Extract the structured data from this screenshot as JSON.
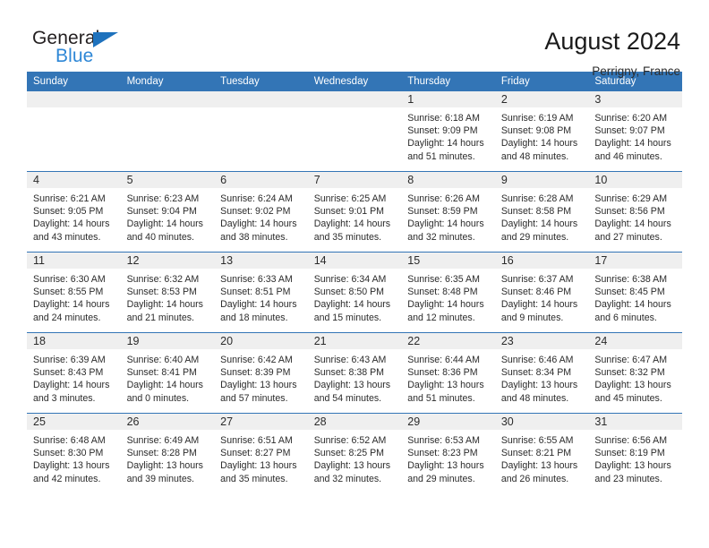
{
  "brand": {
    "name_part1": "General",
    "name_part2": "Blue",
    "flag_icon": "triangle-flag-icon",
    "color_blue": "#2e87d6",
    "color_flag": "#1e72bd"
  },
  "header": {
    "month_title": "August 2024",
    "location": "Perrigny, France"
  },
  "calendar": {
    "accent_color": "#3375b6",
    "band_color": "#efefef",
    "weekday_headers": [
      "Sunday",
      "Monday",
      "Tuesday",
      "Wednesday",
      "Thursday",
      "Friday",
      "Saturday"
    ],
    "weeks": [
      [
        {
          "day": "",
          "sunrise": "",
          "sunset": "",
          "daylight_line1": "",
          "daylight_line2": "",
          "empty": true
        },
        {
          "day": "",
          "sunrise": "",
          "sunset": "",
          "daylight_line1": "",
          "daylight_line2": "",
          "empty": true
        },
        {
          "day": "",
          "sunrise": "",
          "sunset": "",
          "daylight_line1": "",
          "daylight_line2": "",
          "empty": true
        },
        {
          "day": "",
          "sunrise": "",
          "sunset": "",
          "daylight_line1": "",
          "daylight_line2": "",
          "empty": true
        },
        {
          "day": "1",
          "sunrise": "Sunrise: 6:18 AM",
          "sunset": "Sunset: 9:09 PM",
          "daylight_line1": "Daylight: 14 hours",
          "daylight_line2": "and 51 minutes."
        },
        {
          "day": "2",
          "sunrise": "Sunrise: 6:19 AM",
          "sunset": "Sunset: 9:08 PM",
          "daylight_line1": "Daylight: 14 hours",
          "daylight_line2": "and 48 minutes."
        },
        {
          "day": "3",
          "sunrise": "Sunrise: 6:20 AM",
          "sunset": "Sunset: 9:07 PM",
          "daylight_line1": "Daylight: 14 hours",
          "daylight_line2": "and 46 minutes."
        }
      ],
      [
        {
          "day": "4",
          "sunrise": "Sunrise: 6:21 AM",
          "sunset": "Sunset: 9:05 PM",
          "daylight_line1": "Daylight: 14 hours",
          "daylight_line2": "and 43 minutes."
        },
        {
          "day": "5",
          "sunrise": "Sunrise: 6:23 AM",
          "sunset": "Sunset: 9:04 PM",
          "daylight_line1": "Daylight: 14 hours",
          "daylight_line2": "and 40 minutes."
        },
        {
          "day": "6",
          "sunrise": "Sunrise: 6:24 AM",
          "sunset": "Sunset: 9:02 PM",
          "daylight_line1": "Daylight: 14 hours",
          "daylight_line2": "and 38 minutes."
        },
        {
          "day": "7",
          "sunrise": "Sunrise: 6:25 AM",
          "sunset": "Sunset: 9:01 PM",
          "daylight_line1": "Daylight: 14 hours",
          "daylight_line2": "and 35 minutes."
        },
        {
          "day": "8",
          "sunrise": "Sunrise: 6:26 AM",
          "sunset": "Sunset: 8:59 PM",
          "daylight_line1": "Daylight: 14 hours",
          "daylight_line2": "and 32 minutes."
        },
        {
          "day": "9",
          "sunrise": "Sunrise: 6:28 AM",
          "sunset": "Sunset: 8:58 PM",
          "daylight_line1": "Daylight: 14 hours",
          "daylight_line2": "and 29 minutes."
        },
        {
          "day": "10",
          "sunrise": "Sunrise: 6:29 AM",
          "sunset": "Sunset: 8:56 PM",
          "daylight_line1": "Daylight: 14 hours",
          "daylight_line2": "and 27 minutes."
        }
      ],
      [
        {
          "day": "11",
          "sunrise": "Sunrise: 6:30 AM",
          "sunset": "Sunset: 8:55 PM",
          "daylight_line1": "Daylight: 14 hours",
          "daylight_line2": "and 24 minutes."
        },
        {
          "day": "12",
          "sunrise": "Sunrise: 6:32 AM",
          "sunset": "Sunset: 8:53 PM",
          "daylight_line1": "Daylight: 14 hours",
          "daylight_line2": "and 21 minutes."
        },
        {
          "day": "13",
          "sunrise": "Sunrise: 6:33 AM",
          "sunset": "Sunset: 8:51 PM",
          "daylight_line1": "Daylight: 14 hours",
          "daylight_line2": "and 18 minutes."
        },
        {
          "day": "14",
          "sunrise": "Sunrise: 6:34 AM",
          "sunset": "Sunset: 8:50 PM",
          "daylight_line1": "Daylight: 14 hours",
          "daylight_line2": "and 15 minutes."
        },
        {
          "day": "15",
          "sunrise": "Sunrise: 6:35 AM",
          "sunset": "Sunset: 8:48 PM",
          "daylight_line1": "Daylight: 14 hours",
          "daylight_line2": "and 12 minutes."
        },
        {
          "day": "16",
          "sunrise": "Sunrise: 6:37 AM",
          "sunset": "Sunset: 8:46 PM",
          "daylight_line1": "Daylight: 14 hours",
          "daylight_line2": "and 9 minutes."
        },
        {
          "day": "17",
          "sunrise": "Sunrise: 6:38 AM",
          "sunset": "Sunset: 8:45 PM",
          "daylight_line1": "Daylight: 14 hours",
          "daylight_line2": "and 6 minutes."
        }
      ],
      [
        {
          "day": "18",
          "sunrise": "Sunrise: 6:39 AM",
          "sunset": "Sunset: 8:43 PM",
          "daylight_line1": "Daylight: 14 hours",
          "daylight_line2": "and 3 minutes."
        },
        {
          "day": "19",
          "sunrise": "Sunrise: 6:40 AM",
          "sunset": "Sunset: 8:41 PM",
          "daylight_line1": "Daylight: 14 hours",
          "daylight_line2": "and 0 minutes."
        },
        {
          "day": "20",
          "sunrise": "Sunrise: 6:42 AM",
          "sunset": "Sunset: 8:39 PM",
          "daylight_line1": "Daylight: 13 hours",
          "daylight_line2": "and 57 minutes."
        },
        {
          "day": "21",
          "sunrise": "Sunrise: 6:43 AM",
          "sunset": "Sunset: 8:38 PM",
          "daylight_line1": "Daylight: 13 hours",
          "daylight_line2": "and 54 minutes."
        },
        {
          "day": "22",
          "sunrise": "Sunrise: 6:44 AM",
          "sunset": "Sunset: 8:36 PM",
          "daylight_line1": "Daylight: 13 hours",
          "daylight_line2": "and 51 minutes."
        },
        {
          "day": "23",
          "sunrise": "Sunrise: 6:46 AM",
          "sunset": "Sunset: 8:34 PM",
          "daylight_line1": "Daylight: 13 hours",
          "daylight_line2": "and 48 minutes."
        },
        {
          "day": "24",
          "sunrise": "Sunrise: 6:47 AM",
          "sunset": "Sunset: 8:32 PM",
          "daylight_line1": "Daylight: 13 hours",
          "daylight_line2": "and 45 minutes."
        }
      ],
      [
        {
          "day": "25",
          "sunrise": "Sunrise: 6:48 AM",
          "sunset": "Sunset: 8:30 PM",
          "daylight_line1": "Daylight: 13 hours",
          "daylight_line2": "and 42 minutes."
        },
        {
          "day": "26",
          "sunrise": "Sunrise: 6:49 AM",
          "sunset": "Sunset: 8:28 PM",
          "daylight_line1": "Daylight: 13 hours",
          "daylight_line2": "and 39 minutes."
        },
        {
          "day": "27",
          "sunrise": "Sunrise: 6:51 AM",
          "sunset": "Sunset: 8:27 PM",
          "daylight_line1": "Daylight: 13 hours",
          "daylight_line2": "and 35 minutes."
        },
        {
          "day": "28",
          "sunrise": "Sunrise: 6:52 AM",
          "sunset": "Sunset: 8:25 PM",
          "daylight_line1": "Daylight: 13 hours",
          "daylight_line2": "and 32 minutes."
        },
        {
          "day": "29",
          "sunrise": "Sunrise: 6:53 AM",
          "sunset": "Sunset: 8:23 PM",
          "daylight_line1": "Daylight: 13 hours",
          "daylight_line2": "and 29 minutes."
        },
        {
          "day": "30",
          "sunrise": "Sunrise: 6:55 AM",
          "sunset": "Sunset: 8:21 PM",
          "daylight_line1": "Daylight: 13 hours",
          "daylight_line2": "and 26 minutes."
        },
        {
          "day": "31",
          "sunrise": "Sunrise: 6:56 AM",
          "sunset": "Sunset: 8:19 PM",
          "daylight_line1": "Daylight: 13 hours",
          "daylight_line2": "and 23 minutes."
        }
      ]
    ]
  }
}
